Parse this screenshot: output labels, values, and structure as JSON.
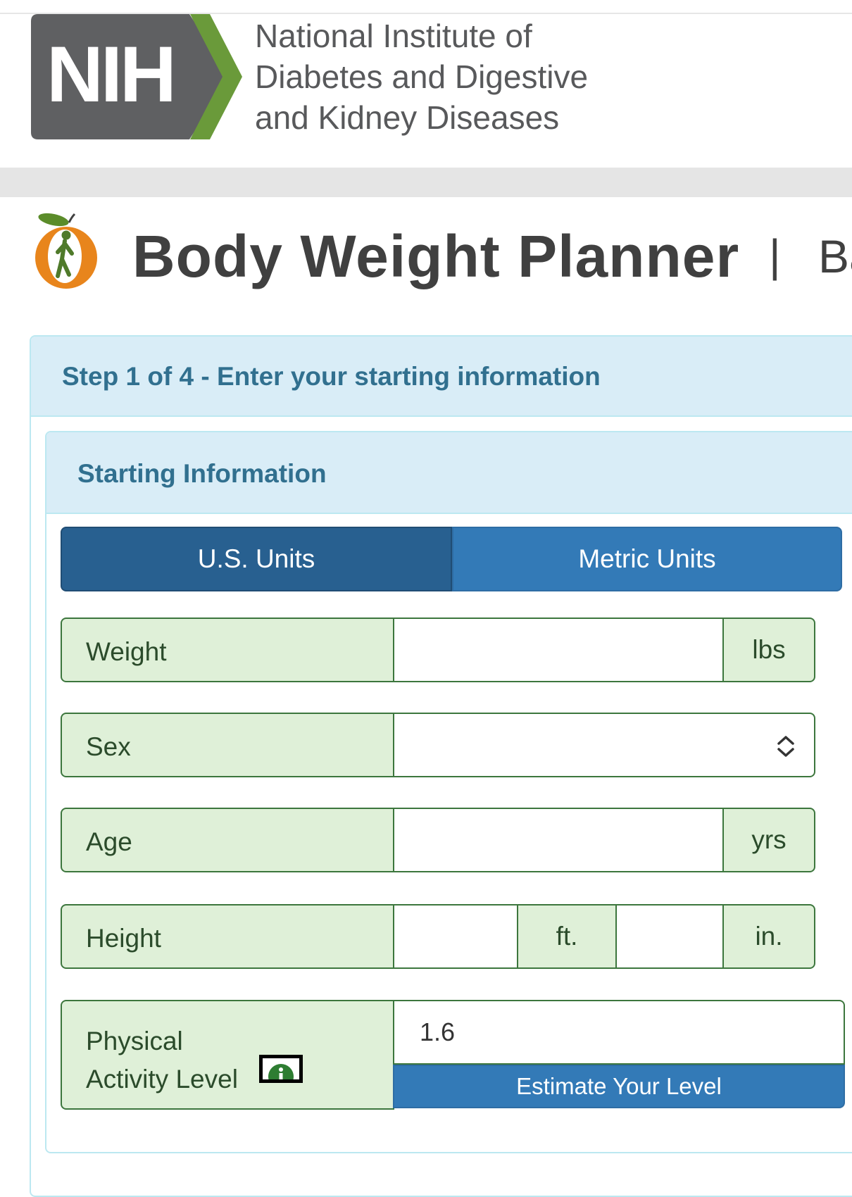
{
  "nih": {
    "logo_text": "NIH",
    "line1": "National Institute of",
    "line2": "Diabetes and Digestive",
    "line3": "and Kidney Diseases"
  },
  "app": {
    "title": "Body Weight Planner",
    "separator": "|",
    "link_text": "Ba"
  },
  "step": {
    "title": "Step 1 of 4 - Enter your starting information"
  },
  "section": {
    "title": "Starting Information"
  },
  "units": {
    "us_label": "U.S. Units",
    "metric_label": "Metric Units",
    "selected": "us"
  },
  "form": {
    "weight": {
      "label": "Weight",
      "value": "",
      "unit": "lbs"
    },
    "sex": {
      "label": "Sex",
      "value": ""
    },
    "age": {
      "label": "Age",
      "value": "",
      "unit": "yrs"
    },
    "height": {
      "label": "Height",
      "feet_value": "",
      "feet_unit": "ft.",
      "inches_value": "",
      "inches_unit": "in."
    },
    "activity": {
      "label_line1": "Physical",
      "label_line2": "Activity Level",
      "value": "1.6",
      "estimate_label": "Estimate Your Level"
    }
  },
  "colors": {
    "accent_blue": "#337ab7",
    "active_blue": "#286090",
    "panel_heading": "#d9edf7",
    "heading_text": "#31708f",
    "field_green": "#dff0d8",
    "field_border": "#3c763d",
    "nih_gray": "#58595b",
    "nih_green": "#6a9a3a"
  }
}
